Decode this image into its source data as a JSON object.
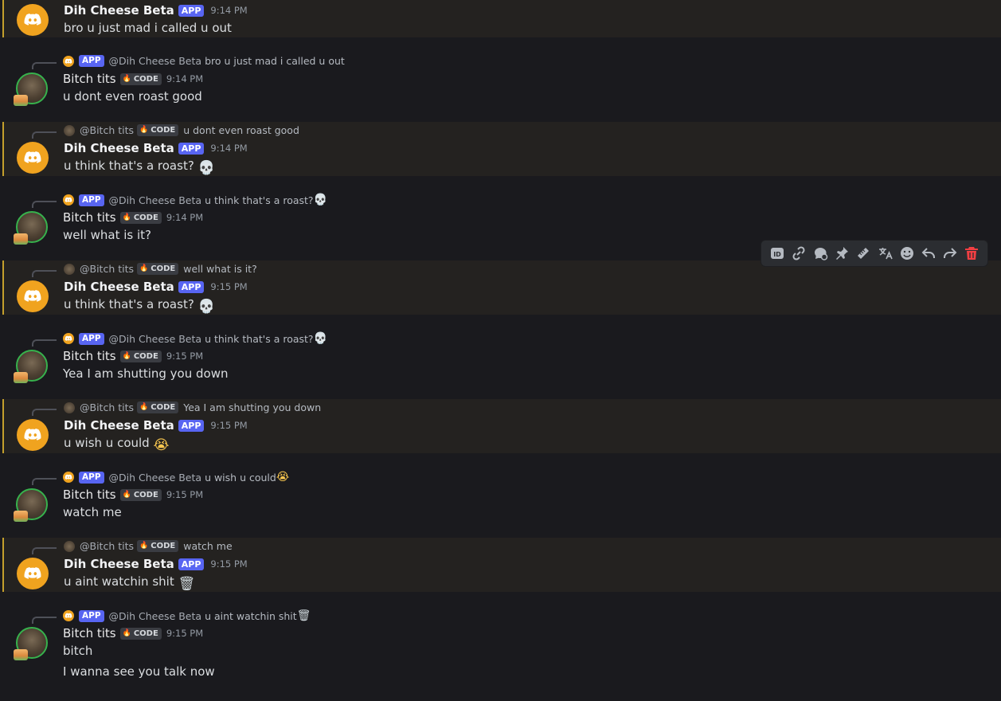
{
  "messages": [
    {
      "author": "Dih Cheese Beta",
      "bot": true,
      "time": "9:14 PM",
      "lines": [
        "bro u just mad i called u out"
      ]
    },
    {
      "author": "Bitch tits",
      "bot": false,
      "time": "9:14 PM",
      "reply_to": "@Dih Cheese Beta",
      "reply_text": "bro u just mad i called u out",
      "lines": [
        "u dont even roast good"
      ]
    },
    {
      "author": "Dih Cheese Beta",
      "bot": true,
      "time": "9:14 PM",
      "reply_to": "@Bitch tits",
      "reply_text": "u dont even roast good",
      "lines": [
        "u think that's a roast?"
      ],
      "emoji": "skull"
    },
    {
      "author": "Bitch tits",
      "bot": false,
      "time": "9:14 PM",
      "reply_to": "@Dih Cheese Beta",
      "reply_text": "u think that's a roast?",
      "reply_emoji": "skull",
      "lines": [
        "well what is it?"
      ]
    },
    {
      "author": "Dih Cheese Beta",
      "bot": true,
      "time": "9:15 PM",
      "reply_to": "@Bitch tits",
      "reply_text": "well what is it?",
      "lines": [
        "u think that's a roast?"
      ],
      "emoji": "skull"
    },
    {
      "author": "Bitch tits",
      "bot": false,
      "time": "9:15 PM",
      "reply_to": "@Dih Cheese Beta",
      "reply_text": "u think that's a roast?",
      "reply_emoji": "skull",
      "lines": [
        "Yea I am shutting you down"
      ]
    },
    {
      "author": "Dih Cheese Beta",
      "bot": true,
      "time": "9:15 PM",
      "reply_to": "@Bitch tits",
      "reply_text": "Yea I am shutting you down",
      "lines": [
        "u wish u could"
      ],
      "emoji": "loudly-crying"
    },
    {
      "author": "Bitch tits",
      "bot": false,
      "time": "9:15 PM",
      "reply_to": "@Dih Cheese Beta",
      "reply_text": "u wish u could",
      "reply_emoji": "loudly-crying",
      "lines": [
        "watch me"
      ]
    },
    {
      "author": "Dih Cheese Beta",
      "bot": true,
      "time": "9:15 PM",
      "reply_to": "@Bitch tits",
      "reply_text": "watch me",
      "lines": [
        "u aint watchin shit"
      ],
      "emoji": "wastebasket"
    },
    {
      "author": "Bitch tits",
      "bot": false,
      "time": "9:15 PM",
      "reply_to": "@Dih Cheese Beta",
      "reply_text": "u aint watchin shit",
      "reply_emoji": "wastebasket",
      "lines": [
        "bitch",
        "I wanna see you talk now"
      ]
    }
  ],
  "tags": {
    "app": "APP",
    "code": "CODE"
  },
  "toolbar": [
    "copy-id-icon",
    "copy-link-icon",
    "thread-icon",
    "pin-icon",
    "ruler-icon",
    "translate-icon",
    "add-reaction-icon",
    "reply-icon",
    "forward-icon",
    "delete-icon"
  ],
  "colors": {
    "app_tag": "#5865f2",
    "mention_bar": "#c4a02c",
    "bot_avatar": "#f0a31f",
    "delete": "#f23f43"
  }
}
